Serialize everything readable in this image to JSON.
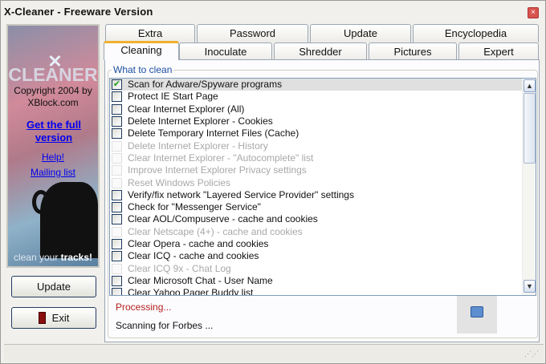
{
  "window": {
    "title": "X-Cleaner  -  Freeware Version",
    "close_label": "×"
  },
  "banner": {
    "logo_x": "✕",
    "logo": "CLEANER",
    "copyright": "Copyright 2004 by",
    "site": "XBlock.com",
    "full_version": "Get the full version",
    "help": "Help!",
    "mailing": "Mailing list",
    "slogan_a": "clean your ",
    "slogan_b": "tracks!"
  },
  "buttons": {
    "update": "Update",
    "exit": "Exit"
  },
  "tabs_row1": [
    "Extra",
    "Password",
    "Update",
    "Encyclopedia"
  ],
  "tabs_row2": [
    "Cleaning",
    "Inoculate",
    "Shredder",
    "Pictures",
    "Expert"
  ],
  "group_label": "What to clean",
  "items": [
    {
      "label": "Scan for Adware/Spyware programs",
      "checked": true,
      "enabled": true
    },
    {
      "label": "Protect IE Start Page",
      "checked": false,
      "enabled": true
    },
    {
      "label": "Clear Internet Explorer (All)",
      "checked": false,
      "enabled": true
    },
    {
      "label": "Delete Internet Explorer - Cookies",
      "checked": false,
      "enabled": true
    },
    {
      "label": "Delete Temporary Internet Files (Cache)",
      "checked": false,
      "enabled": true
    },
    {
      "label": "Delete Internet Explorer - History",
      "checked": false,
      "enabled": false
    },
    {
      "label": "Clear Internet Explorer - \"Autocomplete\" list",
      "checked": false,
      "enabled": false
    },
    {
      "label": "Improve Internet Explorer Privacy settings",
      "checked": false,
      "enabled": false
    },
    {
      "label": "Reset Windows Policies",
      "checked": false,
      "enabled": false
    },
    {
      "label": "Verify/fix network \"Layered Service Provider\" settings",
      "checked": false,
      "enabled": true
    },
    {
      "label": "Check for \"Messenger Service\"",
      "checked": false,
      "enabled": true
    },
    {
      "label": "Clear AOL/Compuserve - cache and cookies",
      "checked": false,
      "enabled": true
    },
    {
      "label": "Clear Netscape (4+) - cache and cookies",
      "checked": false,
      "enabled": false
    },
    {
      "label": "Clear Opera - cache and cookies",
      "checked": false,
      "enabled": true
    },
    {
      "label": "Clear ICQ - cache and cookies",
      "checked": false,
      "enabled": true
    },
    {
      "label": "Clear ICQ 9x  - Chat Log",
      "checked": false,
      "enabled": false
    },
    {
      "label": "Clear Microsoft Chat - User Name",
      "checked": false,
      "enabled": true
    },
    {
      "label": "Clear Yahoo Pager Buddy list",
      "checked": false,
      "enabled": true
    }
  ],
  "status": {
    "processing": "Processing...",
    "scanning": "Scanning for Forbes ..."
  }
}
